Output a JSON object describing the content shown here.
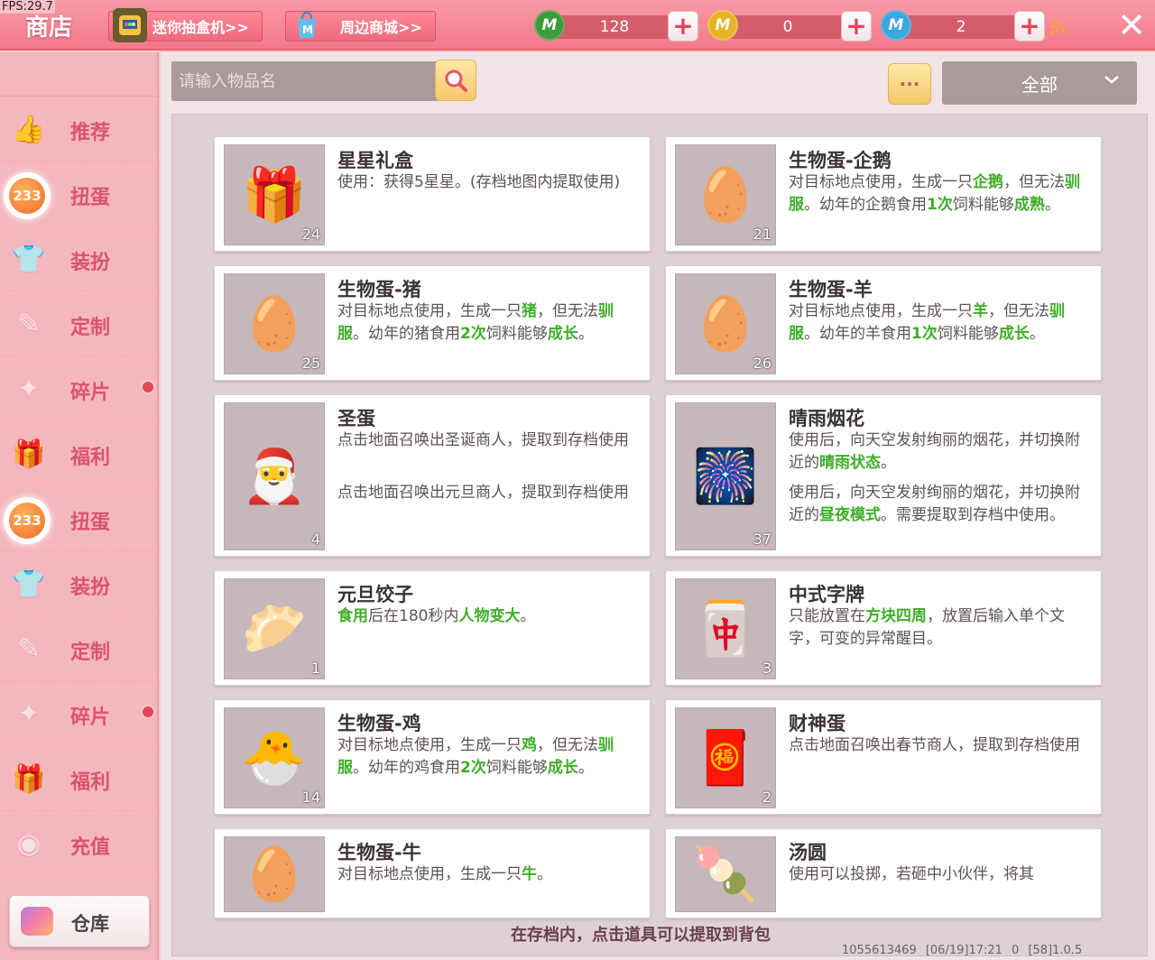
{
  "debug": {
    "fps": "FPS:29.7"
  },
  "header": {
    "title": "商店",
    "blindbox_label": "迷你抽盒机>>",
    "merch_label": "周边商城>>",
    "currencies": [
      {
        "name": "mini-bean",
        "value": "128",
        "color": "#3d9b3a"
      },
      {
        "name": "mini-coin",
        "value": "0",
        "color": "#e7b427"
      },
      {
        "name": "mini-point",
        "value": "2",
        "color": "#3aa7e0"
      }
    ],
    "close": "✕"
  },
  "sidebar": {
    "items": [
      {
        "label": "推荐",
        "icon": "thumbs-up-icon",
        "glyph": "👍"
      },
      {
        "label": "扭蛋",
        "icon": "gacha-icon",
        "badge": "233"
      },
      {
        "label": "装扮",
        "icon": "outfit-icon",
        "glyph": "👕"
      },
      {
        "label": "定制",
        "icon": "custom-pencil-icon",
        "glyph": "✎"
      },
      {
        "label": "碎片",
        "icon": "fragment-icon",
        "glyph": "✦",
        "dot": true
      },
      {
        "label": "福利",
        "icon": "gift-icon",
        "glyph": "🎁"
      },
      {
        "label": "扭蛋",
        "icon": "gacha-icon",
        "badge": "233"
      },
      {
        "label": "装扮",
        "icon": "outfit-icon",
        "glyph": "👕"
      },
      {
        "label": "定制",
        "icon": "custom-pencil-icon",
        "glyph": "✎"
      },
      {
        "label": "碎片",
        "icon": "fragment-icon",
        "glyph": "✦",
        "dot": true
      },
      {
        "label": "福利",
        "icon": "gift-icon",
        "glyph": "🎁"
      },
      {
        "label": "充值",
        "icon": "recharge-icon",
        "glyph": "◉"
      }
    ],
    "warehouse_label": "仓库"
  },
  "toolbar": {
    "search_placeholder": "请输入物品名",
    "more_label": "···",
    "filter_value": "全部"
  },
  "items": [
    {
      "title": "星星礼盒",
      "count": "24",
      "art": "🎁",
      "desc": [
        [
          "使用：获得5星星。(存档地图内提取使用)",
          false
        ]
      ]
    },
    {
      "title": "生物蛋-企鹅",
      "count": "21",
      "art": "🥚",
      "desc": [
        [
          "对目标地点使用，生成一只",
          false
        ],
        [
          "企鹅",
          true
        ],
        [
          "，但无法",
          false
        ],
        [
          "驯服",
          true
        ],
        [
          "。幼年的企鹅食用",
          false
        ],
        [
          "1次",
          true
        ],
        [
          "饲料能够",
          false
        ],
        [
          "成熟",
          true
        ],
        [
          "。",
          false
        ]
      ]
    },
    {
      "title": "生物蛋-猪",
      "count": "25",
      "art": "🥚",
      "desc": [
        [
          "对目标地点使用，生成一只",
          false
        ],
        [
          "猪",
          true
        ],
        [
          "，但无法",
          false
        ],
        [
          "驯服",
          true
        ],
        [
          "。幼年的猪食用",
          false
        ],
        [
          "2次",
          true
        ],
        [
          "饲料能够",
          false
        ],
        [
          "成长",
          true
        ],
        [
          "。",
          false
        ]
      ]
    },
    {
      "title": "生物蛋-羊",
      "count": "26",
      "art": "🥚",
      "desc": [
        [
          "对目标地点使用，生成一只",
          false
        ],
        [
          "羊",
          true
        ],
        [
          "，但无法",
          false
        ],
        [
          "驯服",
          true
        ],
        [
          "。幼年的羊食用",
          false
        ],
        [
          "1次",
          true
        ],
        [
          "饲料能够",
          false
        ],
        [
          "成长",
          true
        ],
        [
          "。",
          false
        ]
      ]
    },
    {
      "title": "圣蛋",
      "count": "4",
      "art": "🎅",
      "desc": [
        [
          "点击地面召唤出圣诞商人，提取到存档使用",
          false
        ]
      ],
      "overlap": "点击地面召唤出元旦商人，提取到存档使用"
    },
    {
      "title": "晴雨烟花",
      "count": "37",
      "art": "🎆",
      "desc": [
        [
          "使用后，向天空发射绚丽的烟花，并切换附近的",
          false
        ],
        [
          "晴雨状态",
          true
        ],
        [
          "。",
          false
        ]
      ],
      "overlap_parts": [
        [
          "使用后，向天空发射绚丽的烟花，并切换附近的",
          false
        ],
        [
          "昼夜模式",
          true
        ],
        [
          "。需要提取到存档中使用。",
          false
        ]
      ]
    },
    {
      "title": "元旦饺子",
      "count": "1",
      "art": "🥟",
      "desc": [
        [
          "食用",
          true
        ],
        [
          "后在180秒内",
          false
        ],
        [
          "人物变大",
          true
        ],
        [
          "。",
          false
        ]
      ]
    },
    {
      "title": "中式字牌",
      "count": "3",
      "art": "🀄",
      "desc": [
        [
          "只能放置在",
          false
        ],
        [
          "方块四周",
          true
        ],
        [
          "，放置后输入单个文字，可变的异常醒目。",
          false
        ]
      ]
    },
    {
      "title": "生物蛋-鸡",
      "count": "14",
      "art": "🐣",
      "desc": [
        [
          "对目标地点使用，生成一只",
          false
        ],
        [
          "鸡",
          true
        ],
        [
          "，但无法",
          false
        ],
        [
          "驯服",
          true
        ],
        [
          "。幼年的鸡食用",
          false
        ],
        [
          "2次",
          true
        ],
        [
          "饲料能够",
          false
        ],
        [
          "成长",
          true
        ],
        [
          "。",
          false
        ]
      ]
    },
    {
      "title": "财神蛋",
      "count": "2",
      "art": "🧧",
      "desc": [
        [
          "点击地面召唤出春节商人，提取到存档使用",
          false
        ]
      ]
    },
    {
      "title": "生物蛋-牛",
      "count": "",
      "art": "🥚",
      "desc": [
        [
          "对目标地点使用，生成一只",
          false
        ],
        [
          "牛",
          true
        ],
        [
          "。",
          false
        ]
      ]
    },
    {
      "title": "汤圆",
      "count": "",
      "art": "🍡",
      "desc": [
        [
          "使用可以投掷，若砸中小伙伴，将其",
          false
        ]
      ]
    }
  ],
  "footer": {
    "tip": "在存档内，点击道具可以提取到背包",
    "version": "1055613469 [06/19]17:21 0 [58]1.0.5"
  }
}
